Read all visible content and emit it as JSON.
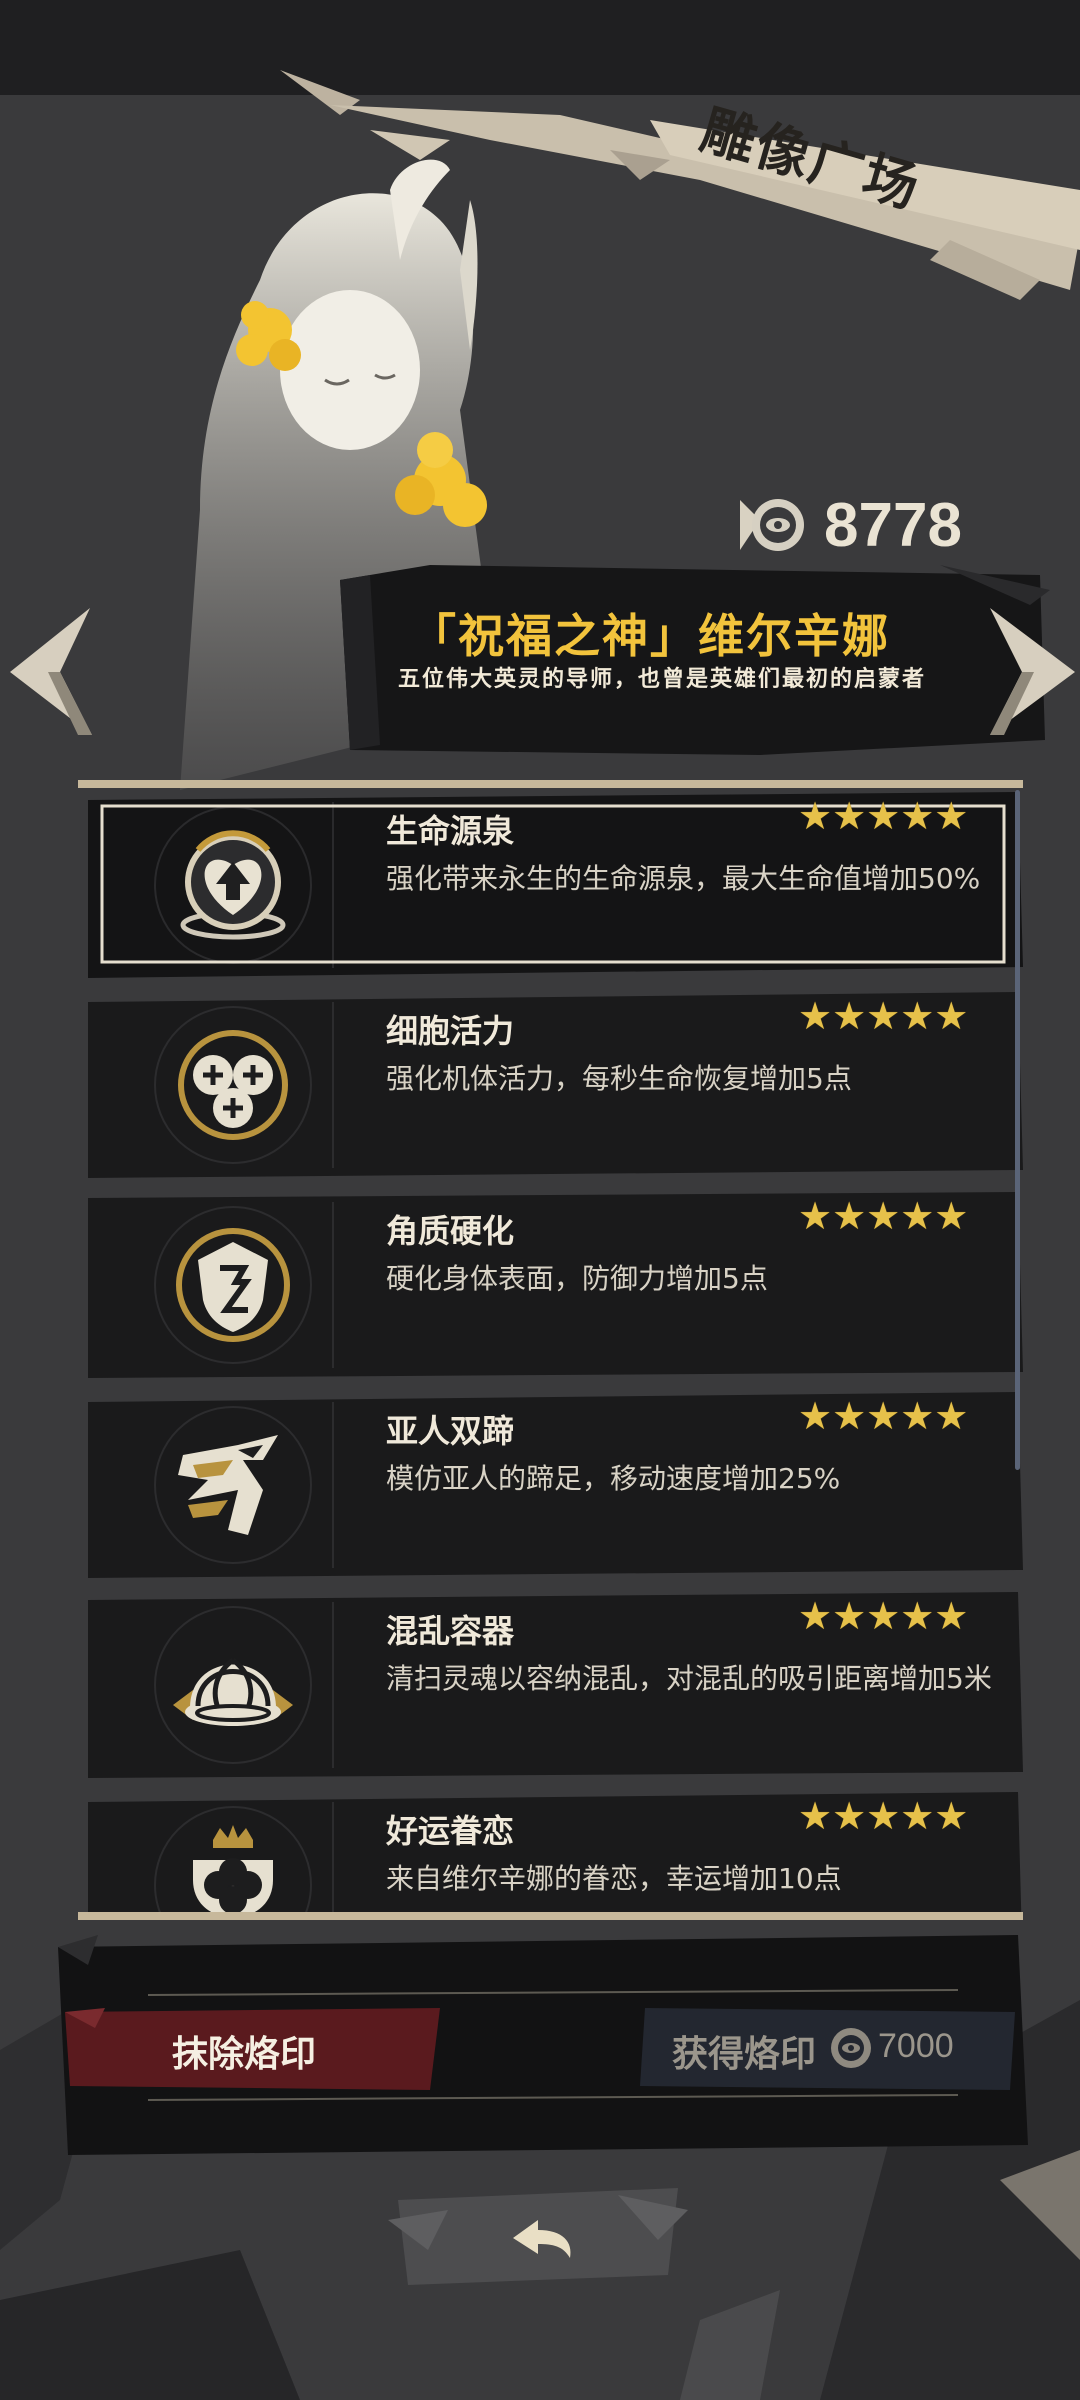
{
  "screen_title": "雕像广场",
  "currency": {
    "icon": "coin-icon",
    "value": "8778"
  },
  "hero": {
    "name": "「祝福之神」维尔辛娜",
    "description": "五位伟大英灵的导师，也曾是英雄们最初的启蒙者"
  },
  "navigation": {
    "prev_icon": "chevron-left-icon",
    "next_icon": "chevron-right-icon"
  },
  "skills": [
    {
      "name": "生命源泉",
      "description": "强化带来永生的生命源泉，最大生命值增加50%",
      "stars": "★★★★★",
      "icon": "heart-arrow-icon",
      "selected": true
    },
    {
      "name": "细胞活力",
      "description": "强化机体活力，每秒生命恢复增加5点",
      "stars": "★★★★★",
      "icon": "cells-icon",
      "selected": false
    },
    {
      "name": "角质硬化",
      "description": "硬化身体表面，防御力增加5点",
      "stars": "★★★★★",
      "icon": "shield-icon",
      "selected": false
    },
    {
      "name": "亚人双蹄",
      "description": "模仿亚人的蹄足，移动速度增加25%",
      "stars": "★★★★★",
      "icon": "hoof-icon",
      "selected": false
    },
    {
      "name": "混乱容器",
      "description": "清扫灵魂以容纳混乱，对混乱的吸引距离增加5米",
      "stars": "★★★★★",
      "icon": "dome-icon",
      "selected": false
    },
    {
      "name": "好运眷恋",
      "description": "来自维尔辛娜的眷恋，幸运增加10点",
      "stars": "★★★★★",
      "icon": "clover-crown-icon",
      "selected": false
    }
  ],
  "actions": {
    "erase_label": "抹除烙印",
    "gain_label": "获得烙印",
    "gain_cost": "7000",
    "back_icon": "back-arrow-icon"
  },
  "colors": {
    "background": "#3a3a3c",
    "gold": "#f2c33c",
    "star": "#e6c14a",
    "erase_button": "#5a1a1e",
    "gain_button": "#232730"
  }
}
